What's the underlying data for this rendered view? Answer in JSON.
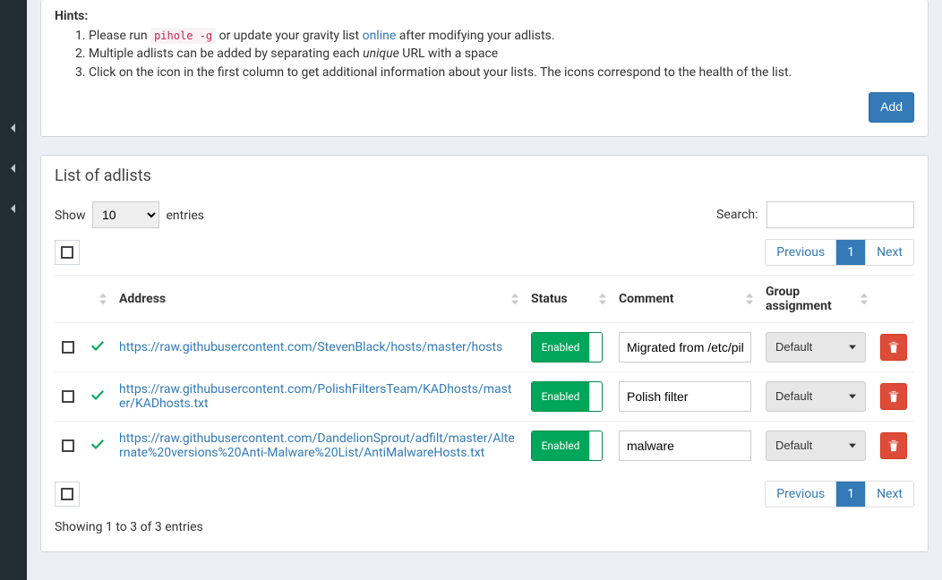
{
  "hints": {
    "title": "Hints:",
    "item1_a": "Please run ",
    "item1_code": "pihole -g",
    "item1_b": " or update your gravity list ",
    "item1_link": "online",
    "item1_c": " after modifying your adlists.",
    "item2_a": "Multiple adlists can be added by separating each ",
    "item2_em": "unique",
    "item2_b": " URL with a space",
    "item3": "Click on the icon in the first column to get additional information about your lists. The icons correspond to the health of the list."
  },
  "buttons": {
    "add": "Add"
  },
  "list": {
    "header": "List of adlists",
    "length_a": "Show",
    "length_b": "entries",
    "length_value": "10",
    "search_label": "Search:",
    "prev": "Previous",
    "page": "1",
    "next": "Next",
    "info": "Showing 1 to 3 of 3 entries",
    "columns": {
      "address": "Address",
      "status": "Status",
      "comment": "Comment",
      "group": "Group assignment"
    },
    "rows": [
      {
        "address": "https://raw.githubusercontent.com/StevenBlack/hosts/master/hosts",
        "status": "Enabled",
        "comment": "Migrated from /etc/pihole/adlists.list",
        "group": "Default"
      },
      {
        "address": "https://raw.githubusercontent.com/PolishFiltersTeam/KADhosts/master/KADhosts.txt",
        "status": "Enabled",
        "comment": "Polish filter",
        "group": "Default"
      },
      {
        "address": "https://raw.githubusercontent.com/DandelionSprout/adfilt/master/Alternate%20versions%20Anti-Malware%20List/AntiMalwareHosts.txt",
        "status": "Enabled",
        "comment": "malware",
        "group": "Default"
      }
    ]
  }
}
